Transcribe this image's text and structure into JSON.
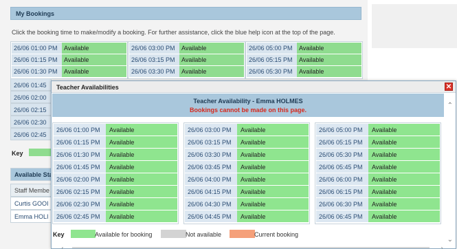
{
  "background": {
    "section_title": "My Bookings",
    "instructions": "Click the booking time to make/modify a booking. For further assistance, click the blue help icon at the top of the page.",
    "columns": [
      [
        {
          "time": "26/06 01:00 PM",
          "status": "Available"
        },
        {
          "time": "26/06 01:15 PM",
          "status": "Available"
        },
        {
          "time": "26/06 01:30 PM",
          "status": "Available"
        }
      ],
      [
        {
          "time": "26/06 03:00 PM",
          "status": "Available"
        },
        {
          "time": "26/06 03:15 PM",
          "status": "Available"
        },
        {
          "time": "26/06 03:30 PM",
          "status": "Available"
        }
      ],
      [
        {
          "time": "26/06 05:00 PM",
          "status": "Available"
        },
        {
          "time": "26/06 05:15 PM",
          "status": "Available"
        },
        {
          "time": "26/06 05:30 PM",
          "status": "Available"
        }
      ]
    ],
    "partial_times": [
      "26/06 01:45",
      "26/06 02:00",
      "26/06 02:15",
      "26/06 02:30",
      "26/06 02:45"
    ],
    "key_label": "Key",
    "staff_header": "Available Sta",
    "staff_rows": [
      "Staff Membe",
      "Curtis GOOI",
      "Emma HOLI"
    ]
  },
  "modal": {
    "title": "Teacher Availabilities",
    "close_glyph": "✕",
    "heading": "Teacher Availability - Emma HOLMES",
    "warning": "Bookings cannot be made on this page.",
    "columns": [
      [
        {
          "time": "26/06 01:00 PM",
          "status": "Available"
        },
        {
          "time": "26/06 01:15 PM",
          "status": "Available"
        },
        {
          "time": "26/06 01:30 PM",
          "status": "Available"
        },
        {
          "time": "26/06 01:45 PM",
          "status": "Available"
        },
        {
          "time": "26/06 02:00 PM",
          "status": "Available"
        },
        {
          "time": "26/06 02:15 PM",
          "status": "Available"
        },
        {
          "time": "26/06 02:30 PM",
          "status": "Available"
        },
        {
          "time": "26/06 02:45 PM",
          "status": "Available"
        }
      ],
      [
        {
          "time": "26/06 03:00 PM",
          "status": "Available"
        },
        {
          "time": "26/06 03:15 PM",
          "status": "Available"
        },
        {
          "time": "26/06 03:30 PM",
          "status": "Available"
        },
        {
          "time": "26/06 03:45 PM",
          "status": "Available"
        },
        {
          "time": "26/06 04:00 PM",
          "status": "Available"
        },
        {
          "time": "26/06 04:15 PM",
          "status": "Available"
        },
        {
          "time": "26/06 04:30 PM",
          "status": "Available"
        },
        {
          "time": "26/06 04:45 PM",
          "status": "Available"
        }
      ],
      [
        {
          "time": "26/06 05:00 PM",
          "status": "Available"
        },
        {
          "time": "26/06 05:15 PM",
          "status": "Available"
        },
        {
          "time": "26/06 05:30 PM",
          "status": "Available"
        },
        {
          "time": "26/06 05:45 PM",
          "status": "Available"
        },
        {
          "time": "26/06 06:00 PM",
          "status": "Available"
        },
        {
          "time": "26/06 06:15 PM",
          "status": "Available"
        },
        {
          "time": "26/06 06:30 PM",
          "status": "Available"
        },
        {
          "time": "26/06 06:45 PM",
          "status": "Available"
        }
      ]
    ],
    "key": {
      "label": "Key",
      "items": [
        {
          "label": "Available for booking",
          "color": "#8fe58f"
        },
        {
          "label": "Not available",
          "color": "#d3d3d3"
        },
        {
          "label": "Current booking",
          "color": "#f5a07a"
        }
      ]
    }
  }
}
